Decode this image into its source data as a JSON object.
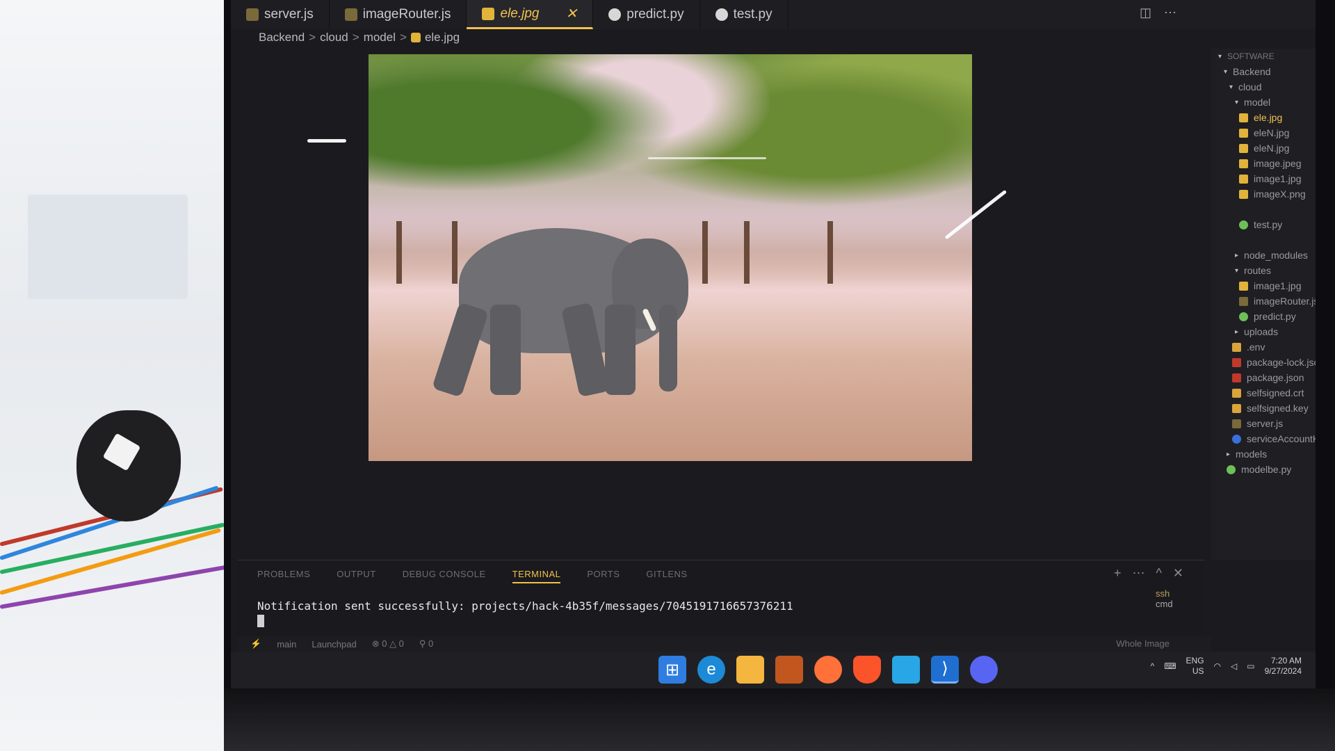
{
  "tabs": [
    {
      "label": "server.js",
      "icon": "js-file-icon"
    },
    {
      "label": "imageRouter.js",
      "icon": "js-file-icon"
    },
    {
      "label": "ele.jpg",
      "icon": "image-file-icon",
      "active": true
    },
    {
      "label": "predict.py",
      "icon": "python-file-icon"
    },
    {
      "label": "test.py",
      "icon": "python-file-icon"
    }
  ],
  "tab_close_glyph": "✕",
  "breadcrumb": [
    "Backend",
    "cloud",
    "model",
    "ele.jpg"
  ],
  "breadcrumb_sep": ">",
  "explorer": {
    "section": "SOFTWARE",
    "items": [
      "Backend",
      "cloud",
      "model",
      "ele.jpg",
      "eleN.jpg",
      "eleN.jpg",
      "image.jpeg",
      "image1.jpg",
      "imageX.png",
      "test.py",
      "node_modules",
      "routes",
      "image1.jpg",
      "imageRouter.js",
      "predict.py",
      "uploads",
      ".env",
      "package-lock.json",
      "package.json",
      "selfsigned.crt",
      "selfsigned.key",
      "server.js",
      "serviceAccountKey",
      "models",
      "modelbe.py"
    ]
  },
  "panel": {
    "tabs": [
      "PROBLEMS",
      "OUTPUT",
      "DEBUG CONSOLE",
      "TERMINAL",
      "PORTS",
      "GITLENS"
    ],
    "active_tab": "TERMINAL",
    "terminal_output": "Notification sent successfully: projects/hack-4b35f/messages/7045191716657376211",
    "terminals": [
      "ssh",
      "cmd"
    ]
  },
  "statusbar": {
    "branch": "main",
    "launchpad": "Launchpad",
    "problems": "⊗ 0 △ 0",
    "ports": "⚲ 0",
    "right": "Whole Image"
  },
  "taskbar": {
    "icons": [
      "windows-start-icon",
      "edge-icon",
      "file-explorer-icon",
      "app-icon",
      "firefox-icon",
      "brave-icon",
      "notepad-icon",
      "vscode-icon",
      "discord-icon"
    ],
    "language": "ENG",
    "region": "US",
    "time": "7:20 AM",
    "date": "9/27/2024"
  }
}
